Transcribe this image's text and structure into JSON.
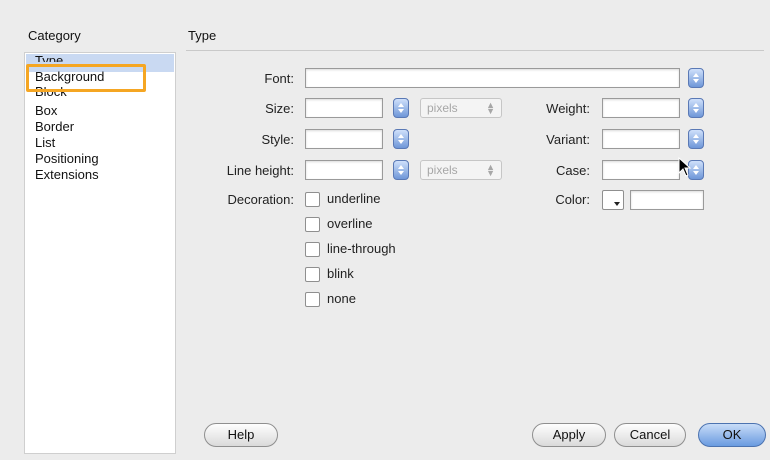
{
  "category": {
    "header": "Category",
    "items": [
      "Type",
      "Background",
      "Block",
      "Box",
      "Border",
      "List",
      "Positioning",
      "Extensions"
    ]
  },
  "panel": {
    "header": "Type",
    "labels": {
      "font": "Font:",
      "size": "Size:",
      "style": "Style:",
      "line_height": "Line height:",
      "decoration": "Decoration:",
      "weight": "Weight:",
      "variant": "Variant:",
      "case": "Case:",
      "color": "Color:"
    },
    "values": {
      "font": "",
      "size": "",
      "style": "",
      "line_height": "",
      "weight": "",
      "variant": "",
      "case": "",
      "color": ""
    },
    "units": {
      "size": "pixels",
      "line_height": "pixels"
    },
    "decorations": [
      "underline",
      "overline",
      "line-through",
      "blink",
      "none"
    ]
  },
  "buttons": {
    "help": "Help",
    "apply": "Apply",
    "cancel": "Cancel",
    "ok": "OK"
  },
  "colors": {
    "highlight": "#f5a623",
    "selection": "#c9d9f2",
    "accent": "#6f97d8"
  }
}
